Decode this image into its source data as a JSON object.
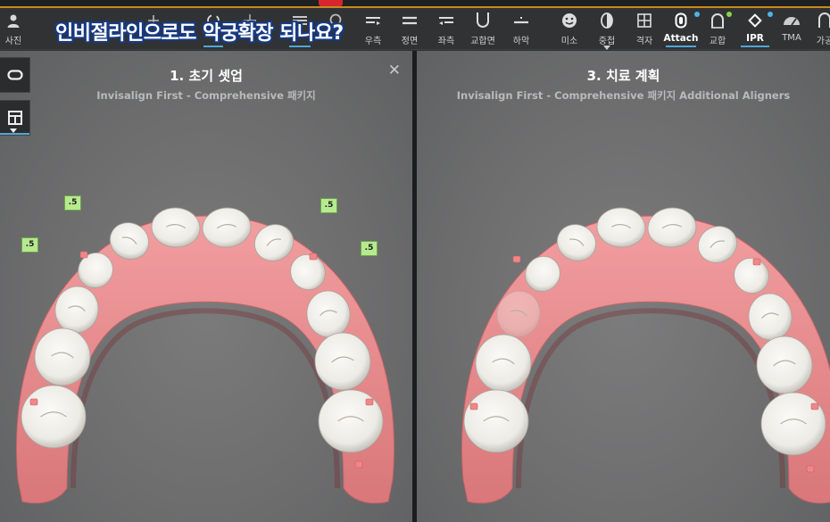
{
  "caption": "인비절라인으로도 악궁확장 되나요?",
  "toolbar": {
    "items": [
      {
        "label": "사진",
        "icon": "person-icon"
      },
      {
        "label": "우측",
        "icon": "right-view-icon"
      },
      {
        "label": "정면",
        "icon": "front-view-icon"
      },
      {
        "label": "좌측",
        "icon": "left-view-icon"
      },
      {
        "label": "교합면",
        "icon": "occlusal-view-icon"
      },
      {
        "label": "하악",
        "icon": "lower-jaw-icon"
      },
      {
        "label": "미소",
        "icon": "smile-icon"
      },
      {
        "label": "중첩",
        "icon": "overlay-icon"
      },
      {
        "label": "격자",
        "icon": "grid-icon"
      },
      {
        "label": "Attach",
        "icon": "attachment-icon"
      },
      {
        "label": "교합",
        "icon": "occlusion-icon"
      },
      {
        "label": "IPR",
        "icon": "ipr-icon"
      },
      {
        "label": "TMA",
        "icon": "tma-gauge-icon"
      },
      {
        "label": "가공",
        "icon": "pontic-icon"
      }
    ]
  },
  "left_panel": {
    "title": "1. 초기 셋업",
    "subtitle": "Invisalign First - Comprehensive 패키지",
    "ipr_labels": [
      ".5",
      ".5",
      ".5",
      ".5"
    ]
  },
  "right_panel": {
    "title": "3. 치료 계획",
    "subtitle": "Invisalign First - Comprehensive 패키지 Additional Aligners"
  },
  "colors": {
    "accent_underline": "#4fa7d6",
    "dot_blue": "#4fb3e8",
    "dot_green": "#8bd44a",
    "ipr_green": "#b6ea8f",
    "gum": "#e88a8c",
    "tooth": "#ecebe6"
  }
}
